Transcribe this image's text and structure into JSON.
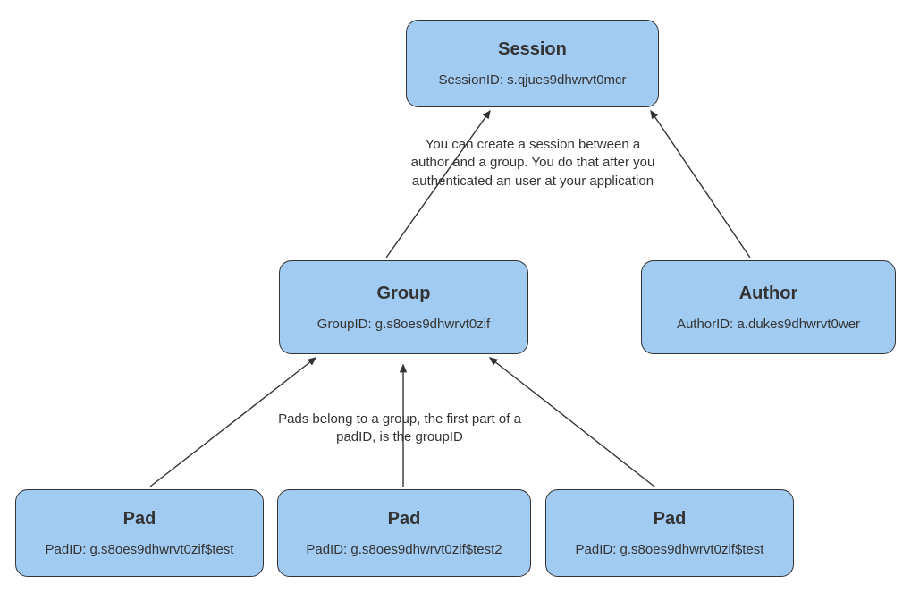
{
  "colors": {
    "node_fill": "#a2cbf2",
    "node_stroke": "#333333",
    "text": "#333333"
  },
  "nodes": {
    "session": {
      "title": "Session",
      "sub": "SessionID: s.qjues9dhwrvt0mcr"
    },
    "group": {
      "title": "Group",
      "sub": "GroupID: g.s8oes9dhwrvt0zif"
    },
    "author": {
      "title": "Author",
      "sub": "AuthorID: a.dukes9dhwrvt0wer"
    },
    "pad1": {
      "title": "Pad",
      "sub": "PadID: g.s8oes9dhwrvt0zif$test"
    },
    "pad2": {
      "title": "Pad",
      "sub": "PadID: g.s8oes9dhwrvt0zif$test2"
    },
    "pad3": {
      "title": "Pad",
      "sub": "PadID: g.s8oes9dhwrvt0zif$test"
    }
  },
  "annotations": {
    "session_text": "You can create a session between a author and a group. You do that after you authenticated an user at your application",
    "pads_text": "Pads belong to a group, the first part of a padID, is the groupID"
  }
}
